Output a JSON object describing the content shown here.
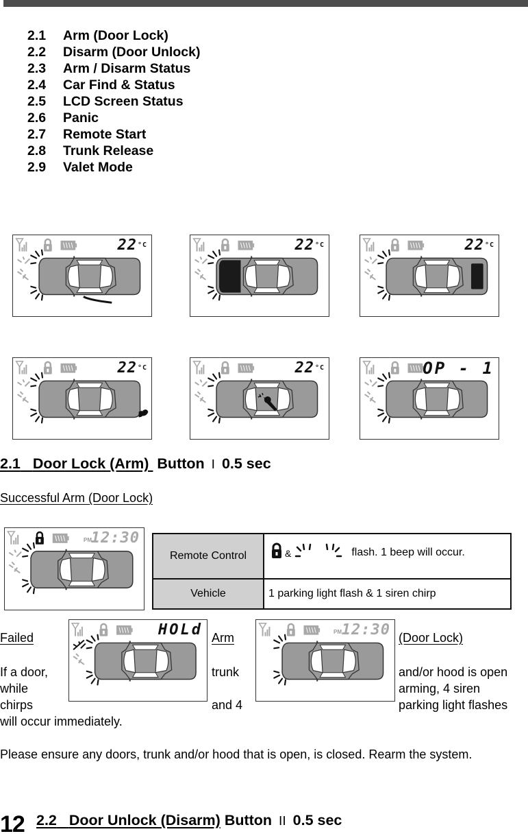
{
  "toc": [
    {
      "num": "2.1",
      "label": "Arm (Door Lock)"
    },
    {
      "num": "2.2",
      "label": "Disarm (Door Unlock)"
    },
    {
      "num": "2.3",
      "label": "Arm / Disarm Status"
    },
    {
      "num": "2.4",
      "label": "Car Find & Status"
    },
    {
      "num": "2.5",
      "label": "LCD Screen Status"
    },
    {
      "num": "2.6",
      "label": "Panic"
    },
    {
      "num": "2.7",
      "label": "Remote Start"
    },
    {
      "num": "2.8",
      "label": "Trunk Release"
    },
    {
      "num": "2.9",
      "label": "Valet Mode"
    }
  ],
  "lcd_gallery": [
    {
      "readout": "22",
      "unit": "°C",
      "highlight": "door-open"
    },
    {
      "readout": "22",
      "unit": "°C",
      "highlight": "hood-open"
    },
    {
      "readout": "22",
      "unit": "°C",
      "highlight": "trunk-open"
    },
    {
      "readout": "22",
      "unit": "°C",
      "highlight": "exhaust-remote-start"
    },
    {
      "readout": "22",
      "unit": "°C",
      "highlight": "shock-sensor"
    },
    {
      "readout": "OP - 1",
      "unit": "",
      "highlight": "none"
    }
  ],
  "section_2_1": {
    "num": "2.1",
    "title": "Door Lock (Arm)",
    "button_text": "Button",
    "button_glyph": "Ⅰ",
    "duration": "0.5 sec",
    "success_heading": "Successful Arm (Door Lock)",
    "success_lcd": {
      "readout": "12:30",
      "pm": "PM",
      "lock": "locked"
    },
    "table": {
      "rows": [
        {
          "label": "Remote Control",
          "amp": "&",
          "value": "flash.  1 beep will occur."
        },
        {
          "label": "Vehicle",
          "value": "1 parking light flash & 1 siren chirp"
        }
      ]
    },
    "failed_heading_1": "Failed",
    "failed_heading_2": "Arm",
    "failed_heading_3": "(Door Lock)",
    "failed_lcd_1": {
      "readout": "HOLd"
    },
    "failed_lcd_2": {
      "readout": "12:30",
      "pm": "PM"
    },
    "failed_text": {
      "col1": [
        "If a door,",
        "while",
        "chirps"
      ],
      "col2": [
        "trunk",
        "",
        "and 4"
      ],
      "col3": [
        "and/or hood is open",
        "arming, 4 siren",
        "parking light flashes"
      ],
      "tail": "will occur immediately."
    },
    "note": "Please ensure any doors, trunk and/or hood that is open, is closed.  Rearm the system."
  },
  "section_2_2": {
    "num": "2.2",
    "title": "Door Unlock (Disarm)",
    "button_text": "Button",
    "button_glyph": "ⅠⅠ",
    "duration": "0.5 sec"
  },
  "page_number": "12",
  "colors": {
    "car_body": "#9a9a9a",
    "lcd_dim": "#a8a8a8",
    "table_label_bg": "#d0d0d0",
    "top_bar": "#4d4d4d"
  }
}
